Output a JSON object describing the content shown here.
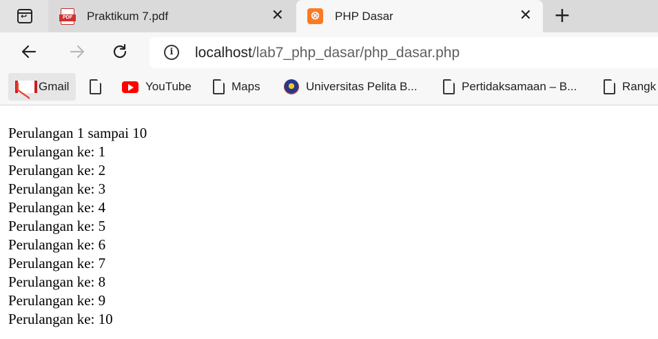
{
  "browser": {
    "tabs": [
      {
        "title": "Praktikum 7.pdf",
        "icon": "pdf-icon",
        "active": false
      },
      {
        "title": "PHP Dasar",
        "icon": "xampp-icon",
        "active": true
      }
    ],
    "close_glyph": "✕",
    "new_tab_glyph": "+",
    "address": {
      "host": "localhost",
      "path": "/lab7_php_dasar/php_dasar.php"
    },
    "bookmarks": [
      {
        "label": "Gmail",
        "icon": "gmail-icon"
      },
      {
        "label": "",
        "icon": "document-icon"
      },
      {
        "label": "YouTube",
        "icon": "youtube-icon"
      },
      {
        "label": "Maps",
        "icon": "document-icon"
      },
      {
        "label": "Universitas Pelita B...",
        "icon": "university-logo-icon"
      },
      {
        "label": "Pertidaksamaan – B...",
        "icon": "document-icon"
      },
      {
        "label": "Rangk",
        "icon": "document-icon"
      }
    ]
  },
  "page": {
    "heading": "Perulangan 1 sampai 10",
    "lines": [
      "Perulangan ke: 1",
      "Perulangan ke: 2",
      "Perulangan ke: 3",
      "Perulangan ke: 4",
      "Perulangan ke: 5",
      "Perulangan ke: 6",
      "Perulangan ke: 7",
      "Perulangan ke: 8",
      "Perulangan ke: 9",
      "Perulangan ke: 10"
    ]
  }
}
